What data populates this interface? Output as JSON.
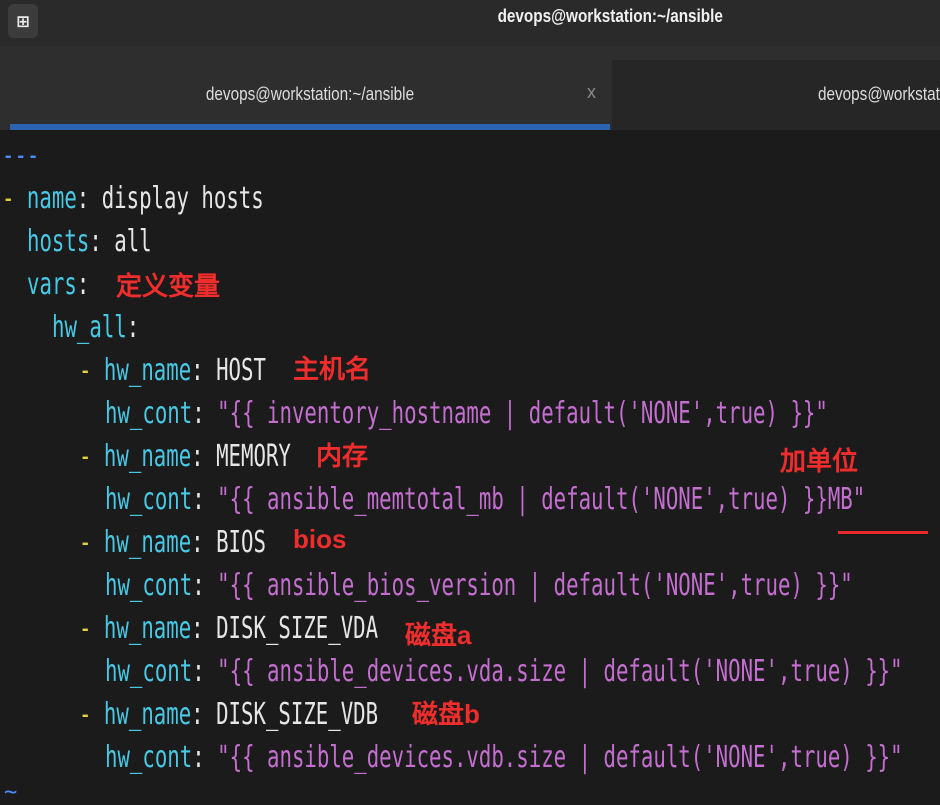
{
  "window": {
    "title": "devops@workstation:~/ansible",
    "new_tab_icon": "⊞"
  },
  "tabs": [
    {
      "label": "devops@workstation:~/ansible",
      "close": "x",
      "active": true
    },
    {
      "label": "devops@workstati",
      "active": false
    }
  ],
  "code": {
    "doc_start": "---",
    "name_key": "name",
    "name_val": "display hosts",
    "hosts_key": "hosts",
    "hosts_val": "all",
    "vars_key": "vars",
    "hw_all_key": "hw_all",
    "items": [
      {
        "dash": "-",
        "name_key": "hw_name",
        "name_val": "HOST",
        "cont_key": "hw_cont",
        "cont_val": "\"{{ inventory_hostname | default('NONE',true) }}\""
      },
      {
        "dash": "-",
        "name_key": "hw_name",
        "name_val": "MEMORY",
        "cont_key": "hw_cont",
        "cont_val": "\"{{ ansible_memtotal_mb | default('NONE',true) }}MB\""
      },
      {
        "dash": "-",
        "name_key": "hw_name",
        "name_val": "BIOS",
        "cont_key": "hw_cont",
        "cont_val": "\"{{ ansible_bios_version | default('NONE',true) }}\""
      },
      {
        "dash": "-",
        "name_key": "hw_name",
        "name_val": "DISK_SIZE_VDA",
        "cont_key": "hw_cont",
        "cont_val": "\"{{ ansible_devices.vda.size | default('NONE',true) }}\""
      },
      {
        "dash": "-",
        "name_key": "hw_name",
        "name_val": "DISK_SIZE_VDB",
        "cont_key": "hw_cont",
        "cont_val": "\"{{ ansible_devices.vdb.size | default('NONE',true) }}\""
      }
    ],
    "tilde": "~"
  },
  "annotations": {
    "vars": "定义变量",
    "host": "主机名",
    "memory": "内存",
    "unit": "加单位",
    "bios": "bios",
    "vda": "磁盘a",
    "vdb": "磁盘b"
  },
  "colors": {
    "key": "#48c8e4",
    "string": "#c46ed0",
    "dash": "#e6d13a",
    "annotation": "#ef2d2d",
    "tab_accent": "#2d63b3"
  }
}
